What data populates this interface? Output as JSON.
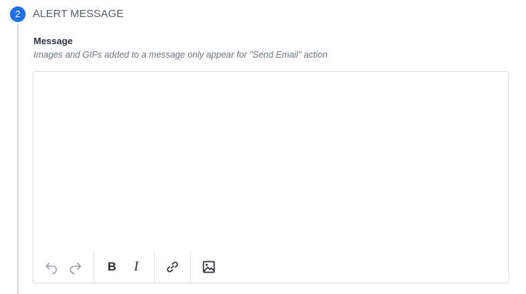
{
  "step": {
    "number": "2",
    "title": "ALERT MESSAGE"
  },
  "message_field": {
    "label": "Message",
    "hint": "Images and GIFs added to a message only appear for \"Send Email\" action",
    "value": ""
  },
  "toolbar": {
    "undo_icon": "undo-icon",
    "redo_icon": "redo-icon",
    "bold_label": "B",
    "italic_label": "I",
    "link_icon": "link-icon",
    "image_icon": "image-icon"
  },
  "colors": {
    "accent": "#1f6fe5",
    "rail": "#d4d6dc",
    "border": "#dcdee3"
  }
}
